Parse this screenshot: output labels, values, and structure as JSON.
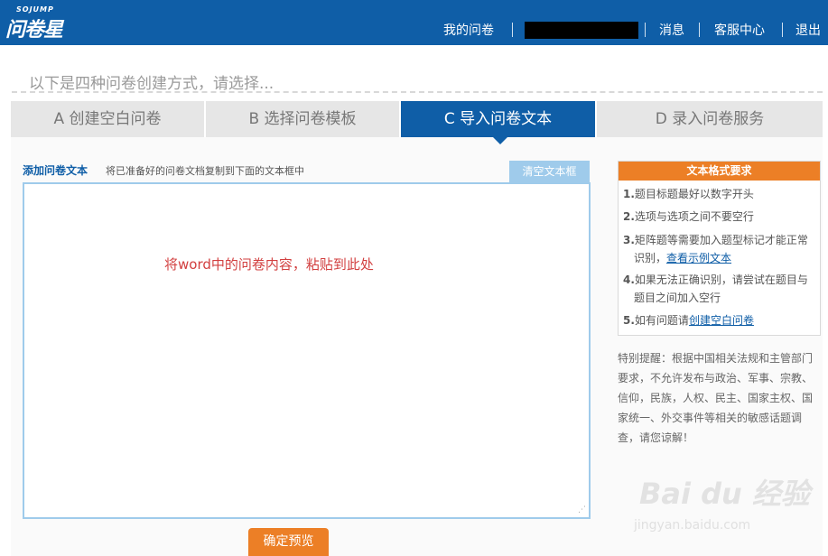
{
  "header": {
    "logo_small": "SOJUMP",
    "logo_main": "问卷星",
    "nav": {
      "my_surveys": "我的问卷",
      "messages": "消息",
      "support": "客服中心",
      "logout": "退出"
    }
  },
  "intro": "以下是四种问卷创建方式，请选择...",
  "tabs": [
    {
      "label": "A 创建空白问卷"
    },
    {
      "label": "B 选择问卷模板"
    },
    {
      "label": "C 导入问卷文本"
    },
    {
      "label": "D 录入问卷服务"
    }
  ],
  "active_tab": "C 导入问卷文本",
  "editor": {
    "title": "添加问卷文本",
    "hint": "将已准备好的问卷文档复制到下面的文本框中",
    "clear_label": "清空文本框",
    "placeholder": "将word中的问卷内容，粘贴到此处",
    "preview_label": "确定预览"
  },
  "format": {
    "title": "文本格式要求",
    "items": [
      {
        "num": "1.",
        "text": "题目标题最好以数字开头"
      },
      {
        "num": "2.",
        "text": "选项与选项之间不要空行"
      },
      {
        "num": "3.",
        "text": "矩阵题等需要加入题型标记才能正常",
        "cont": "识别，",
        "link": "查看示例文本"
      },
      {
        "num": "4.",
        "text": "如果无法正确识别，请尝试在题目与",
        "cont": "题目之间加入空行"
      },
      {
        "num": "5.",
        "text": "如有问题请",
        "link": "创建空白问卷"
      }
    ]
  },
  "notice_lines": [
    "特别提醒：根据中国相关法规和主管部门",
    "要求，不允许发布与政治、军事、宗教、",
    "信仰，民族，人权、民主、国家主权、国",
    "家统一、外交事件等相关的敏感话题调",
    "查，请您谅解！"
  ],
  "watermark": {
    "main": "Bai du 经验",
    "sub": "jingyan.baidu.com"
  },
  "colors": {
    "brand_blue": "#0f5ea7",
    "accent_orange": "#ec7f26",
    "light_blue": "#9fcbeb"
  }
}
